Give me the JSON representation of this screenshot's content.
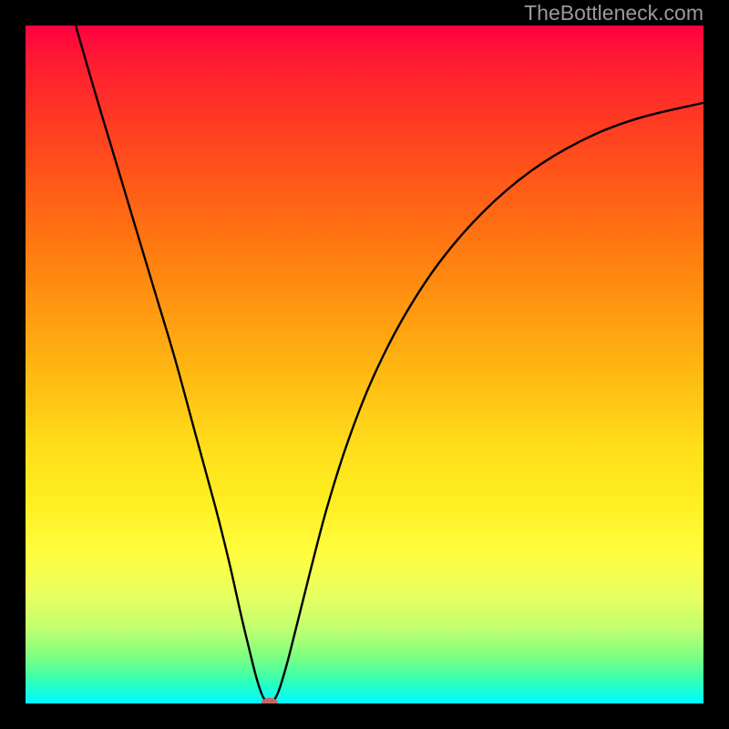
{
  "watermark": "TheBottleneck.com",
  "chart_data": {
    "type": "line",
    "title": "",
    "xlabel": "",
    "ylabel": "",
    "xlim": [
      0,
      1
    ],
    "ylim": [
      0,
      1
    ],
    "legend": false,
    "grid": false,
    "notes": "Axes are unlabeled; values are normalized to the visible plot area. Background is a vertical heat gradient (red at top → green/cyan at bottom). A small pink marker sits at the curve minimum.",
    "curve": [
      {
        "x": 0.074,
        "y": 1.0
      },
      {
        "x": 0.1,
        "y": 0.91
      },
      {
        "x": 0.13,
        "y": 0.81
      },
      {
        "x": 0.16,
        "y": 0.71
      },
      {
        "x": 0.19,
        "y": 0.61
      },
      {
        "x": 0.22,
        "y": 0.51
      },
      {
        "x": 0.25,
        "y": 0.4
      },
      {
        "x": 0.28,
        "y": 0.29
      },
      {
        "x": 0.3,
        "y": 0.21
      },
      {
        "x": 0.318,
        "y": 0.13
      },
      {
        "x": 0.33,
        "y": 0.08
      },
      {
        "x": 0.34,
        "y": 0.04
      },
      {
        "x": 0.348,
        "y": 0.015
      },
      {
        "x": 0.354,
        "y": 0.004
      },
      {
        "x": 0.36,
        "y": 0.0
      },
      {
        "x": 0.366,
        "y": 0.004
      },
      {
        "x": 0.374,
        "y": 0.02
      },
      {
        "x": 0.386,
        "y": 0.06
      },
      {
        "x": 0.4,
        "y": 0.115
      },
      {
        "x": 0.42,
        "y": 0.195
      },
      {
        "x": 0.445,
        "y": 0.29
      },
      {
        "x": 0.475,
        "y": 0.385
      },
      {
        "x": 0.51,
        "y": 0.475
      },
      {
        "x": 0.555,
        "y": 0.565
      },
      {
        "x": 0.61,
        "y": 0.65
      },
      {
        "x": 0.675,
        "y": 0.725
      },
      {
        "x": 0.745,
        "y": 0.785
      },
      {
        "x": 0.82,
        "y": 0.83
      },
      {
        "x": 0.9,
        "y": 0.862
      },
      {
        "x": 1.0,
        "y": 0.886
      }
    ],
    "marker": {
      "x": 0.36,
      "y": 0.0,
      "rx": 0.012,
      "ry": 0.007,
      "color": "#c06868"
    }
  }
}
